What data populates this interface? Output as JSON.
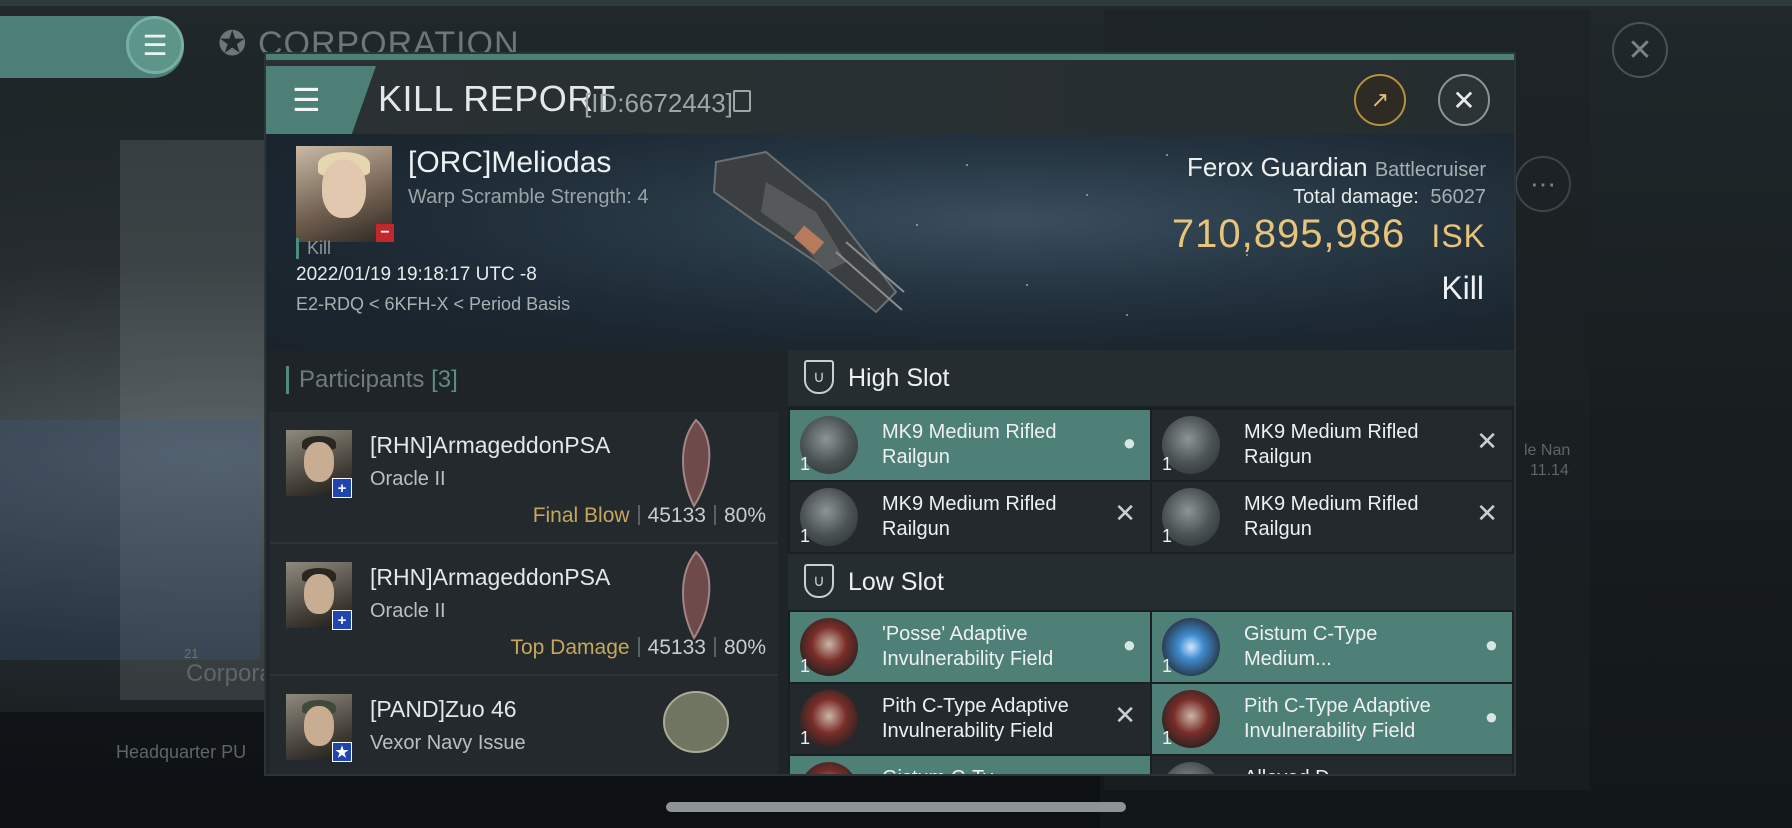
{
  "background": {
    "title": "CORPORATION",
    "corp_label": "Corpora",
    "corp_count": "21",
    "hq_label": "Headquarter PU",
    "side_name": "le Nan",
    "side_num": "11.14",
    "menu_icon": "hamburger-icon",
    "close_icon": "close-icon",
    "more_icon": "more-dots-icon"
  },
  "modal": {
    "title": "KILL REPORT",
    "id_text": "[ID:6672443]",
    "share_icon": "share-icon",
    "close_icon": "close-icon"
  },
  "victim": {
    "name": "[ORC]Meliodas",
    "sub": "Warp Scramble Strength: 4",
    "kill_tag": "Kill",
    "datetime": "2022/01/19 19:18:17 UTC -8",
    "location": "E2-RDQ < 6KFH-X < Period Basis",
    "ship_name": "Ferox Guardian",
    "ship_class": "Battlecruiser",
    "total_damage_label": "Total damage:",
    "total_damage": "56027",
    "isk_value": "710,895,986",
    "isk_unit": "ISK",
    "result": "Kill"
  },
  "participants": {
    "label": "Participants",
    "count": "[3]",
    "rows": [
      {
        "name": "[RHN]ArmageddonPSA",
        "ship": "Oracle II",
        "tag": "Final Blow",
        "damage": "45133",
        "pct": "80%"
      },
      {
        "name": "[RHN]ArmageddonPSA",
        "ship": "Oracle II",
        "tag": "Top Damage",
        "damage": "45133",
        "pct": "80%"
      },
      {
        "name": "[PAND]Zuo 46",
        "ship": "Vexor Navy Issue",
        "tag": "",
        "damage": "",
        "pct": ""
      }
    ]
  },
  "slots": {
    "high": {
      "label": "High Slot",
      "modules": [
        {
          "name": "MK9 Medium Rifled Railgun",
          "qty": "1",
          "state": "dropped"
        },
        {
          "name": "MK9 Medium Rifled Railgun",
          "qty": "1",
          "state": "destroyed"
        },
        {
          "name": "MK9 Medium Rifled Railgun",
          "qty": "1",
          "state": "destroyed"
        },
        {
          "name": "MK9 Medium Rifled Railgun",
          "qty": "1",
          "state": "destroyed"
        }
      ]
    },
    "low": {
      "label": "Low Slot",
      "modules": [
        {
          "name": "'Posse' Adaptive Invulnerability Field",
          "qty": "1",
          "state": "dropped"
        },
        {
          "name": "Gistum C-Type Medium...",
          "qty": "1",
          "state": "dropped"
        },
        {
          "name": "Pith C-Type Adaptive Invulnerability Field",
          "qty": "1",
          "state": "destroyed"
        },
        {
          "name": "Pith C-Type Adaptive Invulnerability Field",
          "qty": "1",
          "state": "dropped"
        }
      ],
      "partial": [
        "Gistum C-Ty...",
        "Alloyed D..."
      ]
    }
  },
  "colors": {
    "accent": "#4f8078",
    "isk": "#e6c47a",
    "gold_label": "#c6a75d"
  }
}
